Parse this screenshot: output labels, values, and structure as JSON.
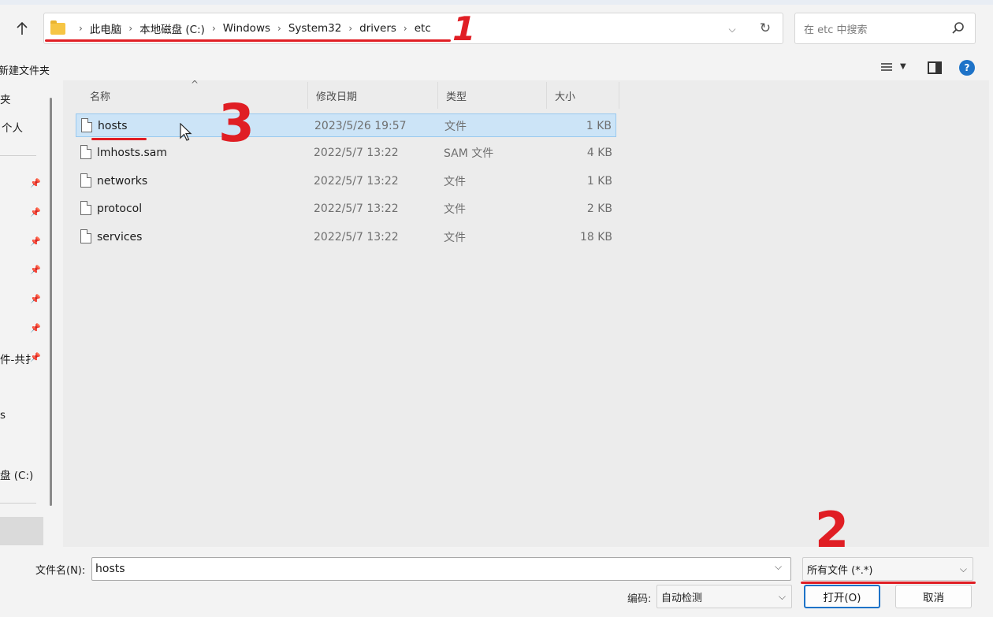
{
  "address_bar": {
    "crumbs": [
      "此电脑",
      "本地磁盘 (C:)",
      "Windows",
      "System32",
      "drivers",
      "etc"
    ]
  },
  "search": {
    "placeholder": "在 etc 中搜索"
  },
  "toolbar": {
    "new_folder_label": "新建文件夹"
  },
  "sidebar": {
    "items": [
      "夹",
      "个人",
      "件-共扌",
      "s",
      "盘 (C:)"
    ]
  },
  "columns": {
    "name": "名称",
    "date": "修改日期",
    "type": "类型",
    "size": "大小"
  },
  "files": [
    {
      "name": "hosts",
      "date": "2023/5/26 19:57",
      "type": "文件",
      "size": "1 KB",
      "selected": true
    },
    {
      "name": "lmhosts.sam",
      "date": "2022/5/7 13:22",
      "type": "SAM 文件",
      "size": "4 KB"
    },
    {
      "name": "networks",
      "date": "2022/5/7 13:22",
      "type": "文件",
      "size": "1 KB"
    },
    {
      "name": "protocol",
      "date": "2022/5/7 13:22",
      "type": "文件",
      "size": "2 KB"
    },
    {
      "name": "services",
      "date": "2022/5/7 13:22",
      "type": "文件",
      "size": "18 KB"
    }
  ],
  "bottom": {
    "filename_label": "文件名(N):",
    "filename_value": "hosts",
    "filetype_value": "所有文件 (*.*)",
    "encoding_label": "编码:",
    "encoding_value": "自动检测",
    "open_label": "打开(O)",
    "cancel_label": "取消"
  },
  "annotations": {
    "mark_1": "1",
    "mark_2": "2",
    "mark_3": "3"
  },
  "colors": {
    "annotation_red": "#e01e24",
    "selection": "#cce4f7",
    "accent": "#1e73c8"
  }
}
